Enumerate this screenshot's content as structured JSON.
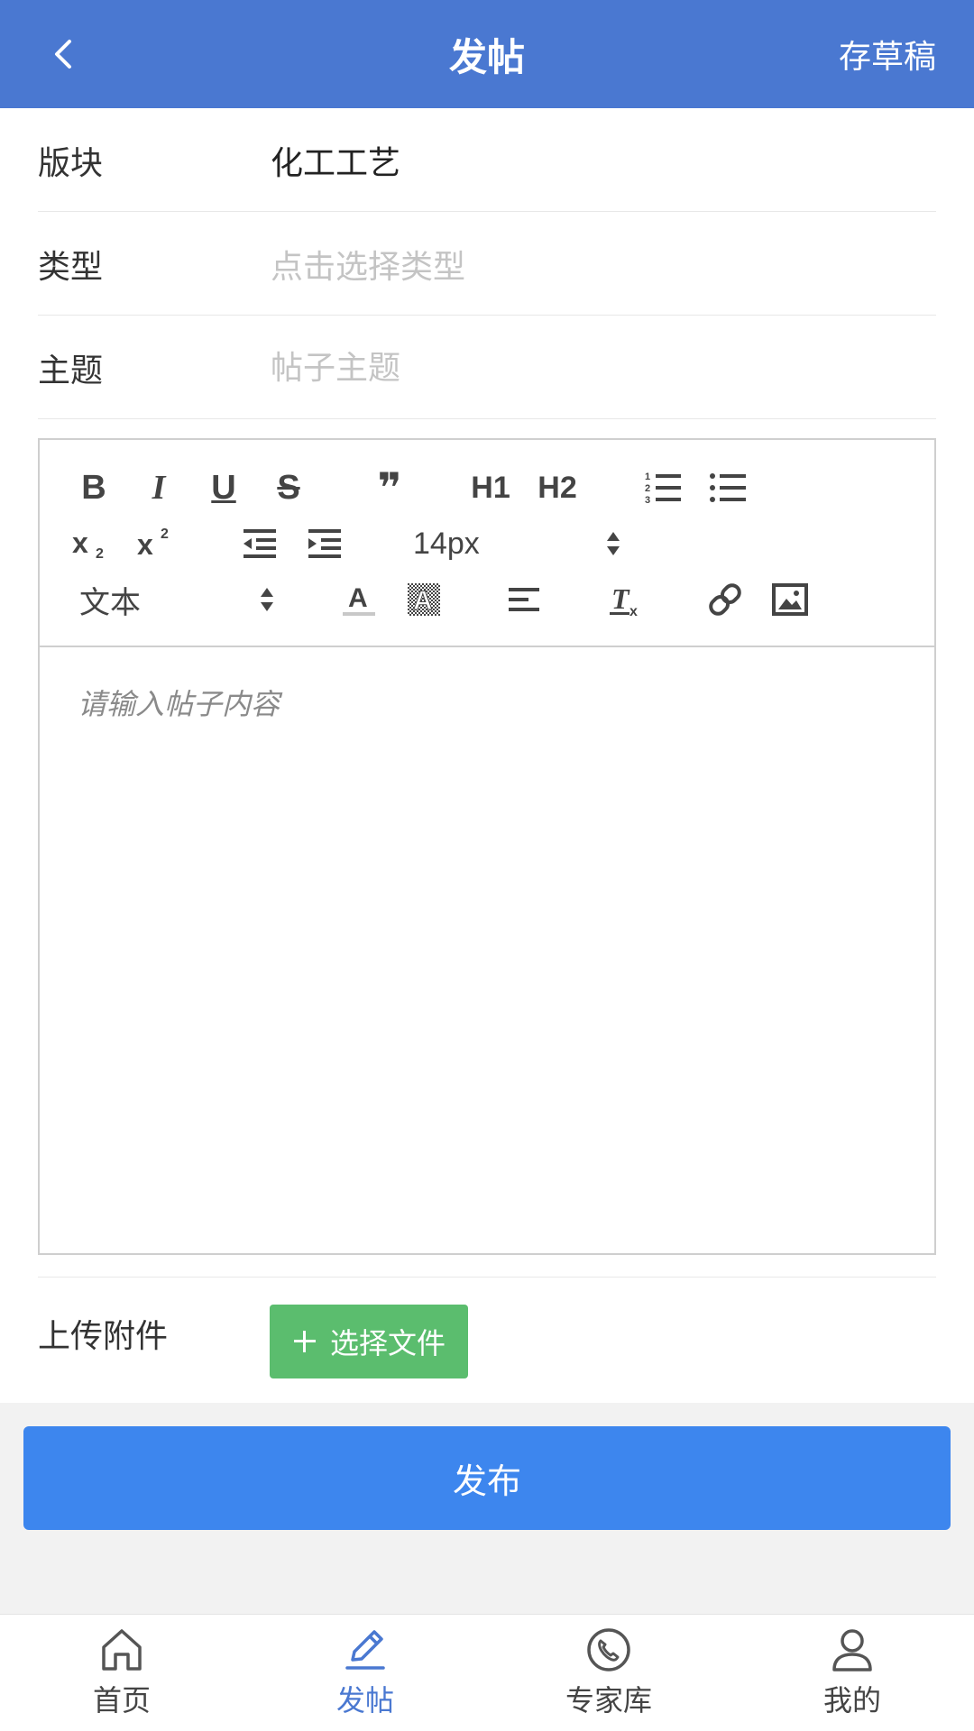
{
  "header": {
    "title": "发帖",
    "draft_label": "存草稿"
  },
  "form": {
    "section_label": "版块",
    "section_value": "化工工艺",
    "type_label": "类型",
    "type_placeholder": "点击选择类型",
    "subject_label": "主题",
    "subject_placeholder": "帖子主题"
  },
  "editor": {
    "toolbar": {
      "bold": "B",
      "italic": "I",
      "underline": "U",
      "strike": "S",
      "quote": "❞",
      "h1": "H1",
      "h2": "H2",
      "font_size": "14px",
      "format": "文本"
    },
    "content_placeholder": "请输入帖子内容"
  },
  "attachment": {
    "label": "上传附件",
    "button_label": "选择文件"
  },
  "publish_label": "发布",
  "bottom_nav": {
    "items": [
      {
        "label": "首页",
        "icon": "home-icon"
      },
      {
        "label": "发帖",
        "icon": "pen-icon",
        "active": true
      },
      {
        "label": "专家库",
        "icon": "phone-icon"
      },
      {
        "label": "我的",
        "icon": "user-icon"
      }
    ]
  },
  "colors": {
    "header": "#4a78d1",
    "publish": "#3d86ee",
    "file_button": "#5bbd6e",
    "active_nav": "#4a78d1"
  }
}
